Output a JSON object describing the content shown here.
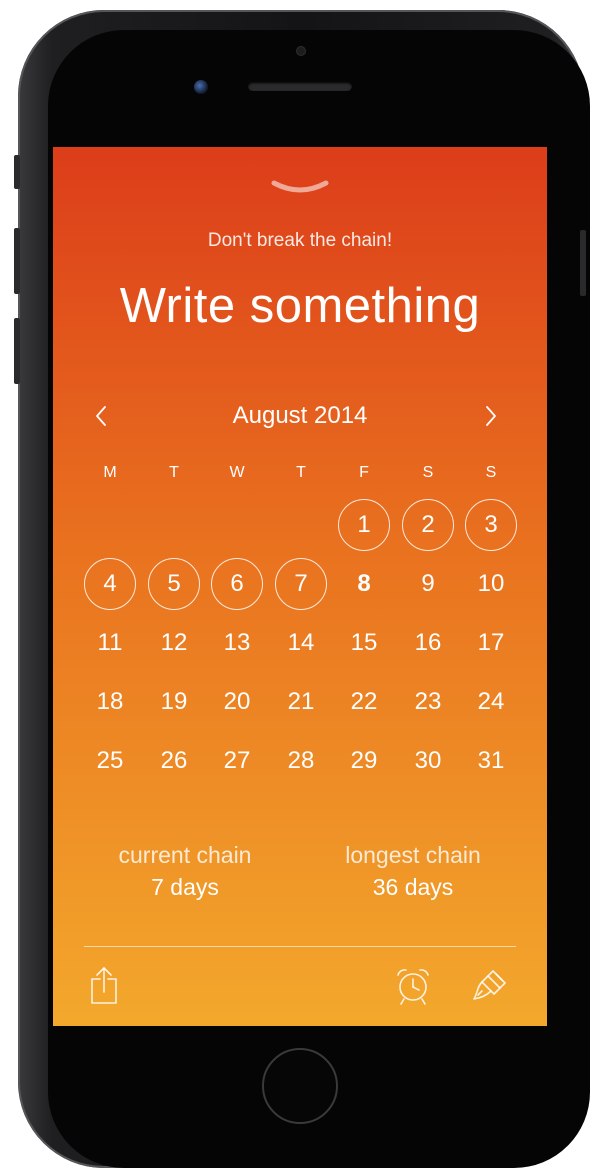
{
  "screen": {
    "subtitle": "Don't break the chain!",
    "habit_title": "Write something",
    "pull_handle_icon": "chevron-down-icon"
  },
  "calendar": {
    "month_label": "August 2014",
    "prev_icon": "chevron-left-icon",
    "next_icon": "chevron-right-icon",
    "weekdays": [
      "M",
      "T",
      "W",
      "T",
      "F",
      "S",
      "S"
    ],
    "first_weekday_index": 4,
    "days_in_month": 31,
    "completed_days": [
      1,
      2,
      3,
      4,
      5,
      6,
      7
    ],
    "today": 8
  },
  "stats": {
    "current_label": "current chain",
    "current_value": "7 days",
    "longest_label": "longest chain",
    "longest_value": "36 days"
  },
  "toolbar": {
    "share_icon": "share-icon",
    "reminder_icon": "alarm-clock-icon",
    "theme_icon": "paint-brush-icon"
  },
  "colors": {
    "gradient_top": "#dc3d1a",
    "gradient_mid": "#e9711f",
    "gradient_bottom": "#f3a82c",
    "text": "#ffffff",
    "phone_frame": "#141416"
  }
}
